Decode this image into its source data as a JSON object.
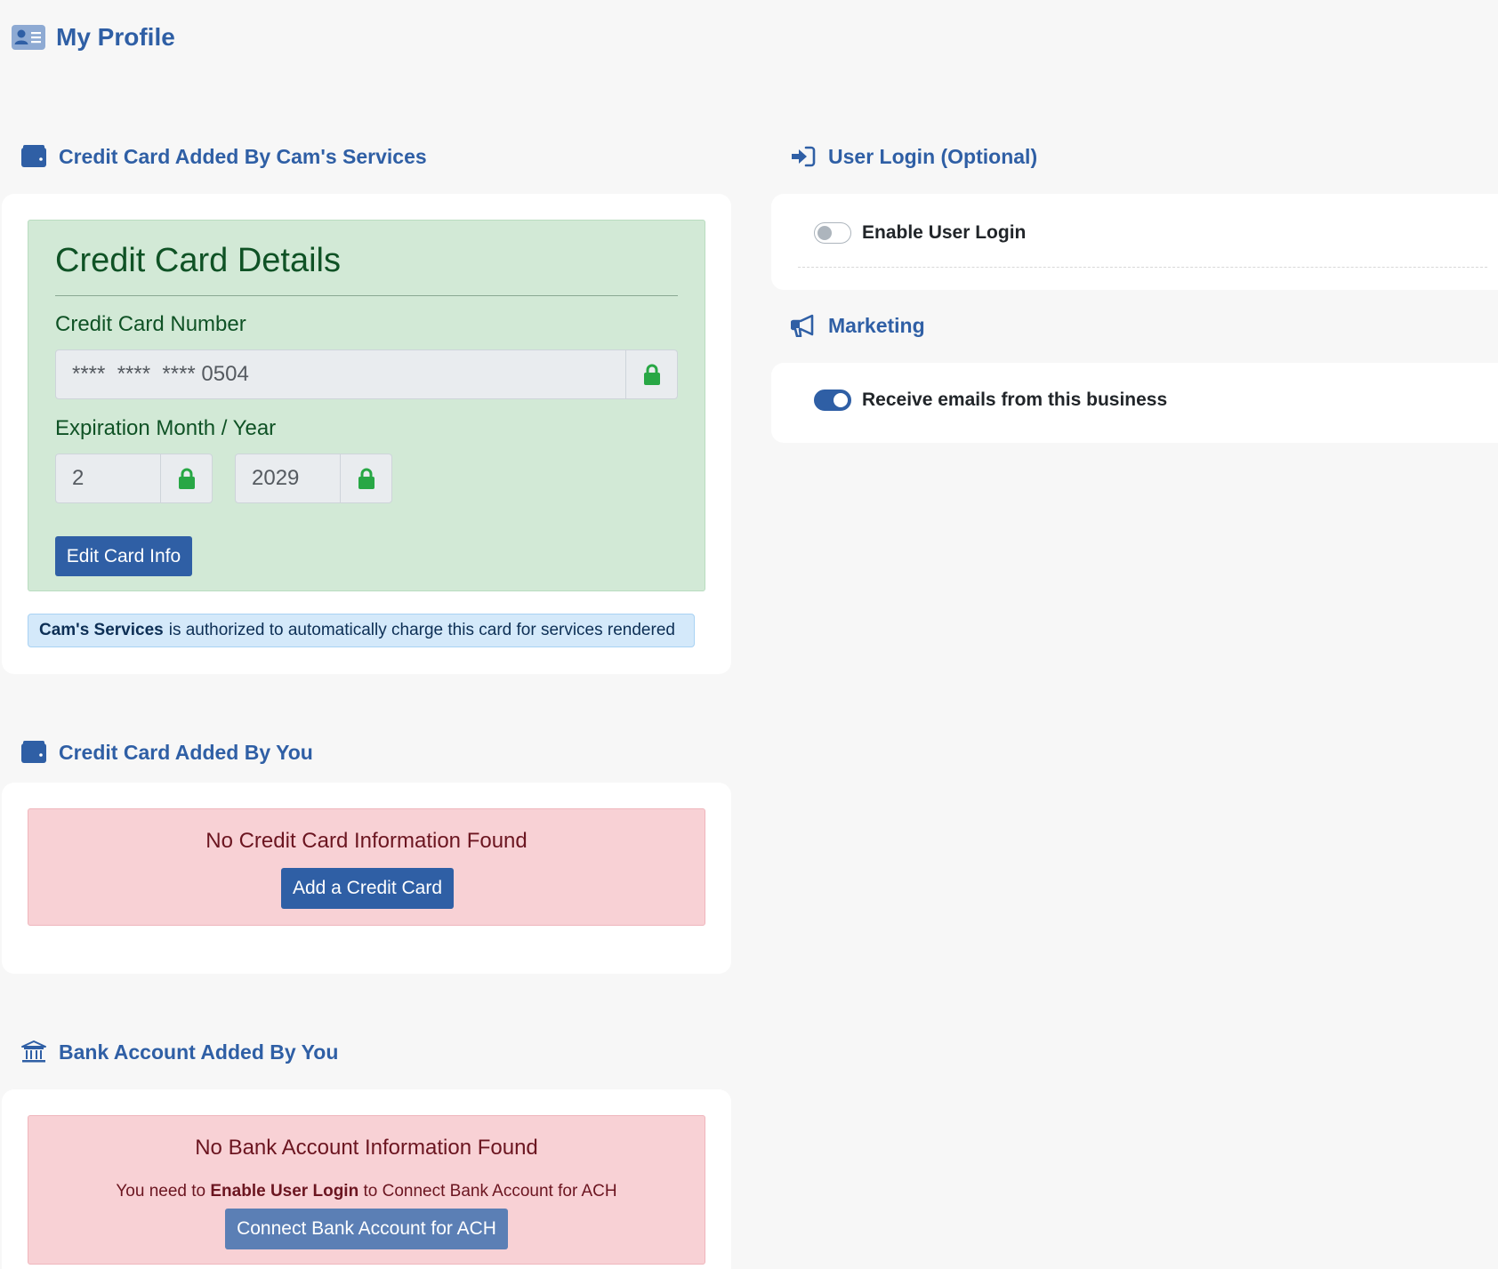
{
  "page": {
    "title": "My Profile",
    "title_icon": "profile-card-icon"
  },
  "card_by_business": {
    "header": "Credit Card Added By Cam's Services",
    "header_icon": "wallet-icon",
    "details_title": "Credit Card Details",
    "number_label": "Credit Card Number",
    "number_value": "****  ****  **** 0504",
    "expiration_label": "Expiration Month / Year",
    "month_value": "2",
    "year_value": "2029",
    "lock_icon": "lock-icon",
    "edit_button": "Edit Card Info",
    "authorization_business": "Cam's Services",
    "authorization_text": "is authorized to automatically charge this card for services rendered"
  },
  "card_by_you": {
    "header": "Credit Card Added By You",
    "header_icon": "wallet-icon",
    "empty_message": "No Credit Card Information Found",
    "add_button": "Add a Credit Card"
  },
  "bank_by_you": {
    "header": "Bank Account Added By You",
    "header_icon": "bank-icon",
    "empty_message": "No Bank Account Information Found",
    "need_prefix": "You need to",
    "need_bold": "Enable User Login",
    "need_suffix": "to Connect Bank Account for ACH",
    "connect_button": "Connect Bank Account for ACH"
  },
  "user_login": {
    "header": "User Login (Optional)",
    "header_icon": "sign-in-icon",
    "toggle_label": "Enable User Login",
    "enabled": false
  },
  "marketing": {
    "header": "Marketing",
    "header_icon": "megaphone-icon",
    "toggle_label": "Receive emails from this business",
    "enabled": true
  },
  "colors": {
    "accent": "#2f5fa5",
    "success_bg": "#d2e9d6",
    "danger_bg": "#f8d1d5",
    "info_bg": "#d4e9fa",
    "lock_green": "#28a745"
  }
}
